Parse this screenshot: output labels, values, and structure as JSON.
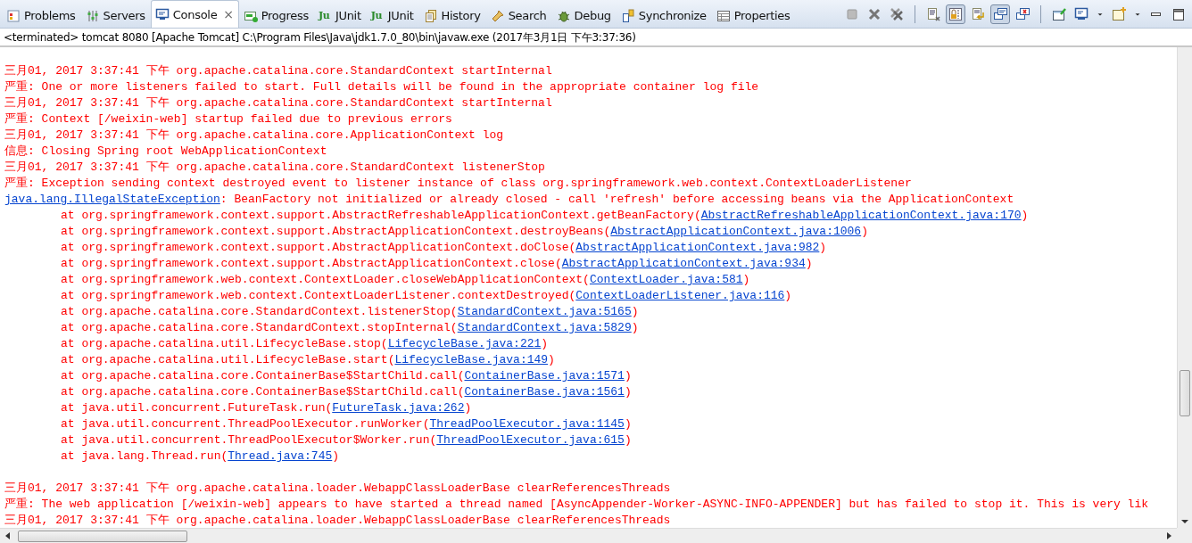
{
  "tabs": [
    {
      "label": "Problems",
      "selected": false,
      "closable": false
    },
    {
      "label": "Servers",
      "selected": false,
      "closable": false
    },
    {
      "label": "Console",
      "selected": true,
      "closable": true
    },
    {
      "label": "Progress",
      "selected": false,
      "closable": false
    },
    {
      "label": "JUnit",
      "icon_text": "Ju",
      "selected": false,
      "closable": false
    },
    {
      "label": "JUnit",
      "icon_text": "Ju",
      "selected": false,
      "closable": false
    },
    {
      "label": "History",
      "selected": false,
      "closable": false
    },
    {
      "label": "Search",
      "selected": false,
      "closable": false
    },
    {
      "label": "Debug",
      "selected": false,
      "closable": false
    },
    {
      "label": "Synchronize",
      "selected": false,
      "closable": false
    },
    {
      "label": "Properties",
      "selected": false,
      "closable": false
    }
  ],
  "close_glyph": "×",
  "toolbar_toggles": [
    {
      "on": true
    },
    {
      "on": false
    },
    {
      "on": true
    },
    {
      "on": false
    }
  ],
  "description": "<terminated> tomcat 8080 [Apache Tomcat] C:\\Program Files\\Java\\jdk1.7.0_80\\bin\\javaw.exe (2017年3月1日 下午3:37:36)",
  "lines": [
    {
      "kind": "blank"
    },
    {
      "kind": "message",
      "segments": [
        {
          "kind": "text",
          "text": "三月01, 2017 3:37:41 下午 org.apache.catalina.core.StandardContext startInternal"
        }
      ]
    },
    {
      "kind": "message",
      "segments": [
        {
          "kind": "text",
          "text": "严重: One or more listeners failed to start. Full details will be found in the appropriate container log file"
        }
      ]
    },
    {
      "kind": "message",
      "segments": [
        {
          "kind": "text",
          "text": "三月01, 2017 3:37:41 下午 org.apache.catalina.core.StandardContext startInternal"
        }
      ]
    },
    {
      "kind": "message",
      "segments": [
        {
          "kind": "text",
          "text": "严重: Context [/weixin-web] startup failed due to previous errors"
        }
      ]
    },
    {
      "kind": "message",
      "segments": [
        {
          "kind": "text",
          "text": "三月01, 2017 3:37:41 下午 org.apache.catalina.core.ApplicationContext log"
        }
      ]
    },
    {
      "kind": "message",
      "segments": [
        {
          "kind": "text",
          "text": "信息: Closing Spring root WebApplicationContext"
        }
      ]
    },
    {
      "kind": "message",
      "segments": [
        {
          "kind": "text",
          "text": "三月01, 2017 3:37:41 下午 org.apache.catalina.core.StandardContext listenerStop"
        }
      ]
    },
    {
      "kind": "message",
      "segments": [
        {
          "kind": "text",
          "text": "严重: Exception sending context destroyed event to listener instance of class org.springframework.web.context.ContextLoaderListener"
        }
      ]
    },
    {
      "kind": "message",
      "segments": [
        {
          "kind": "link",
          "text": "java.lang.IllegalStateException"
        },
        {
          "kind": "text",
          "text": ": BeanFactory not initialized or already closed - call 'refresh' before accessing beans via the ApplicationContext"
        }
      ]
    },
    {
      "kind": "frame",
      "segments": [
        {
          "kind": "text",
          "text": "at org.springframework.context.support.AbstractRefreshableApplicationContext.getBeanFactory("
        },
        {
          "kind": "link",
          "text": "AbstractRefreshableApplicationContext.java:170"
        },
        {
          "kind": "text",
          "text": ")"
        }
      ]
    },
    {
      "kind": "frame",
      "segments": [
        {
          "kind": "text",
          "text": "at org.springframework.context.support.AbstractApplicationContext.destroyBeans("
        },
        {
          "kind": "link",
          "text": "AbstractApplicationContext.java:1006"
        },
        {
          "kind": "text",
          "text": ")"
        }
      ]
    },
    {
      "kind": "frame",
      "segments": [
        {
          "kind": "text",
          "text": "at org.springframework.context.support.AbstractApplicationContext.doClose("
        },
        {
          "kind": "link",
          "text": "AbstractApplicationContext.java:982"
        },
        {
          "kind": "text",
          "text": ")"
        }
      ]
    },
    {
      "kind": "frame",
      "segments": [
        {
          "kind": "text",
          "text": "at org.springframework.context.support.AbstractApplicationContext.close("
        },
        {
          "kind": "link",
          "text": "AbstractApplicationContext.java:934"
        },
        {
          "kind": "text",
          "text": ")"
        }
      ]
    },
    {
      "kind": "frame",
      "segments": [
        {
          "kind": "text",
          "text": "at org.springframework.web.context.ContextLoader.closeWebApplicationContext("
        },
        {
          "kind": "link",
          "text": "ContextLoader.java:581"
        },
        {
          "kind": "text",
          "text": ")"
        }
      ]
    },
    {
      "kind": "frame",
      "segments": [
        {
          "kind": "text",
          "text": "at org.springframework.web.context.ContextLoaderListener.contextDestroyed("
        },
        {
          "kind": "link",
          "text": "ContextLoaderListener.java:116"
        },
        {
          "kind": "text",
          "text": ")"
        }
      ]
    },
    {
      "kind": "frame",
      "segments": [
        {
          "kind": "text",
          "text": "at org.apache.catalina.core.StandardContext.listenerStop("
        },
        {
          "kind": "link",
          "text": "StandardContext.java:5165"
        },
        {
          "kind": "text",
          "text": ")"
        }
      ]
    },
    {
      "kind": "frame",
      "segments": [
        {
          "kind": "text",
          "text": "at org.apache.catalina.core.StandardContext.stopInternal("
        },
        {
          "kind": "link",
          "text": "StandardContext.java:5829"
        },
        {
          "kind": "text",
          "text": ")"
        }
      ]
    },
    {
      "kind": "frame",
      "segments": [
        {
          "kind": "text",
          "text": "at org.apache.catalina.util.LifecycleBase.stop("
        },
        {
          "kind": "link",
          "text": "LifecycleBase.java:221"
        },
        {
          "kind": "text",
          "text": ")"
        }
      ]
    },
    {
      "kind": "frame",
      "segments": [
        {
          "kind": "text",
          "text": "at org.apache.catalina.util.LifecycleBase.start("
        },
        {
          "kind": "link",
          "text": "LifecycleBase.java:149"
        },
        {
          "kind": "text",
          "text": ")"
        }
      ]
    },
    {
      "kind": "frame",
      "segments": [
        {
          "kind": "text",
          "text": "at org.apache.catalina.core.ContainerBase$StartChild.call("
        },
        {
          "kind": "link",
          "text": "ContainerBase.java:1571"
        },
        {
          "kind": "text",
          "text": ")"
        }
      ]
    },
    {
      "kind": "frame",
      "segments": [
        {
          "kind": "text",
          "text": "at org.apache.catalina.core.ContainerBase$StartChild.call("
        },
        {
          "kind": "link",
          "text": "ContainerBase.java:1561"
        },
        {
          "kind": "text",
          "text": ")"
        }
      ]
    },
    {
      "kind": "frame",
      "segments": [
        {
          "kind": "text",
          "text": "at java.util.concurrent.FutureTask.run("
        },
        {
          "kind": "link",
          "text": "FutureTask.java:262"
        },
        {
          "kind": "text",
          "text": ")"
        }
      ]
    },
    {
      "kind": "frame",
      "segments": [
        {
          "kind": "text",
          "text": "at java.util.concurrent.ThreadPoolExecutor.runWorker("
        },
        {
          "kind": "link",
          "text": "ThreadPoolExecutor.java:1145"
        },
        {
          "kind": "text",
          "text": ")"
        }
      ]
    },
    {
      "kind": "frame",
      "segments": [
        {
          "kind": "text",
          "text": "at java.util.concurrent.ThreadPoolExecutor$Worker.run("
        },
        {
          "kind": "link",
          "text": "ThreadPoolExecutor.java:615"
        },
        {
          "kind": "text",
          "text": ")"
        }
      ]
    },
    {
      "kind": "frame",
      "segments": [
        {
          "kind": "text",
          "text": "at java.lang.Thread.run("
        },
        {
          "kind": "link",
          "text": "Thread.java:745"
        },
        {
          "kind": "text",
          "text": ")"
        }
      ]
    },
    {
      "kind": "blank"
    },
    {
      "kind": "message",
      "segments": [
        {
          "kind": "text",
          "text": "三月01, 2017 3:37:41 下午 org.apache.catalina.loader.WebappClassLoaderBase clearReferencesThreads"
        }
      ]
    },
    {
      "kind": "message",
      "segments": [
        {
          "kind": "text",
          "text": "严重: The web application [/weixin-web] appears to have started a thread named [AsyncAppender-Worker-ASYNC-INFO-APPENDER] but has failed to stop it. This is very lik"
        }
      ]
    },
    {
      "kind": "message",
      "segments": [
        {
          "kind": "text",
          "text": "三月01, 2017 3:37:41 下午 org.apache.catalina.loader.WebappClassLoaderBase clearReferencesThreads"
        }
      ]
    }
  ]
}
